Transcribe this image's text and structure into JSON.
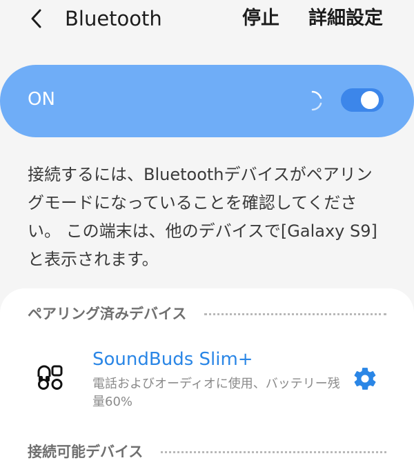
{
  "header": {
    "title": "Bluetooth",
    "stop_label": "停止",
    "advanced_label": "詳細設定",
    "back_icon": "chevron-left-icon"
  },
  "toggle_bar": {
    "state_label": "ON",
    "enabled": true,
    "scanning": true,
    "color": "#6fadf7",
    "toggle_color": "#3c86ea"
  },
  "description": {
    "text": "接続するには、Bluetoothデバイスがペアリングモードになっていることを確認してください。 この端末は、他のデバイスで[Galaxy S9]と表示されます。"
  },
  "paired_section": {
    "title": "ペアリング済みデバイス",
    "devices": [
      {
        "name": "SoundBuds Slim+",
        "status": "電話およびオーディオに使用、バッテリー残量60%",
        "icon": "headset-device-icon",
        "settings_icon": "gear-icon"
      }
    ]
  },
  "available_section": {
    "title": "接続可能デバイス"
  }
}
